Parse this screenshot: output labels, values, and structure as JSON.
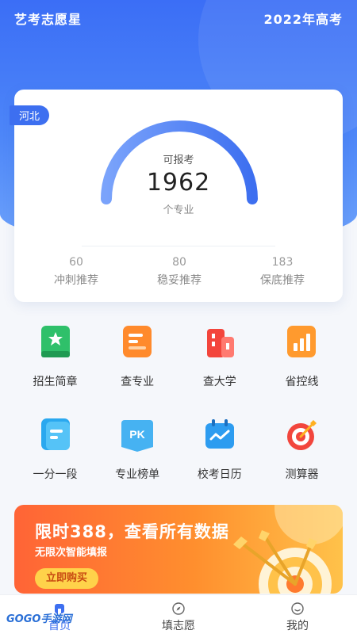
{
  "header": {
    "app_title": "艺考志愿星",
    "year_label": "2022年高考"
  },
  "summary": {
    "province": "河北",
    "caption_top": "可报考",
    "total": "1962",
    "caption_bottom": "个专业",
    "stats": [
      {
        "value": "60",
        "label": "冲刺推荐"
      },
      {
        "value": "80",
        "label": "稳妥推荐"
      },
      {
        "value": "183",
        "label": "保底推荐"
      }
    ]
  },
  "features": [
    {
      "label": "招生简章",
      "icon": "admissions-book-icon"
    },
    {
      "label": "查专业",
      "icon": "major-search-icon"
    },
    {
      "label": "查大学",
      "icon": "university-building-icon"
    },
    {
      "label": "省控线",
      "icon": "bar-chart-icon"
    },
    {
      "label": "一分一段",
      "icon": "score-segment-icon"
    },
    {
      "label": "专业榜单",
      "icon": "pk-ranking-icon"
    },
    {
      "label": "校考日历",
      "icon": "calendar-icon"
    },
    {
      "label": "测算器",
      "icon": "target-icon"
    }
  ],
  "banner": {
    "title": "限时388，查看所有数据",
    "subtitle": "无限次智能填报",
    "button": "立即购买"
  },
  "tabs": [
    {
      "label": "首页",
      "icon": "home-icon",
      "active": true
    },
    {
      "label": "填志愿",
      "icon": "compass-icon",
      "active": false
    },
    {
      "label": "我的",
      "icon": "profile-icon",
      "active": false
    }
  ],
  "watermark": "GOGO手游网",
  "colors": {
    "primary": "#3d6ff0",
    "banner_start": "#ff6436",
    "banner_end": "#ffc24a"
  }
}
